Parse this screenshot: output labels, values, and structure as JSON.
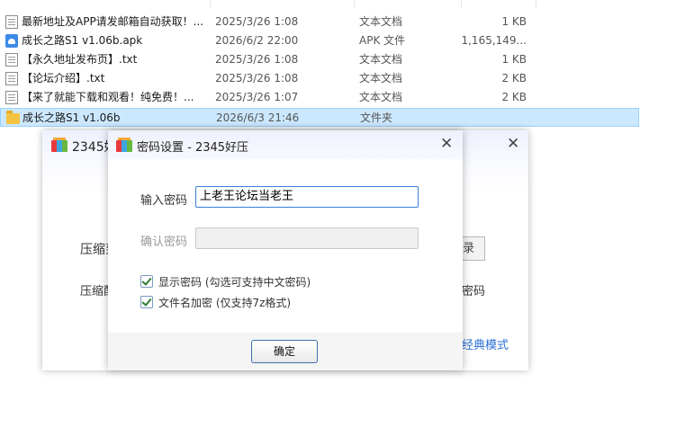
{
  "files": [
    {
      "name": "最新地址及APP请发邮箱自动获取！...",
      "date": "2025/3/26 1:08",
      "type": "文本文档",
      "size": "1 KB",
      "icon": "text-file-icon"
    },
    {
      "name": "成长之路S1 v1.06b.apk",
      "date": "2026/6/2 22:00",
      "type": "APK 文件",
      "size": "1,165,149...",
      "icon": "apk-file-icon"
    },
    {
      "name": "【永久地址发布页】.txt",
      "date": "2025/3/26 1:08",
      "type": "文本文档",
      "size": "1 KB",
      "icon": "text-file-icon"
    },
    {
      "name": "【论坛介绍】.txt",
      "date": "2025/3/26 1:08",
      "type": "文本文档",
      "size": "2 KB",
      "icon": "text-file-icon"
    },
    {
      "name": "【来了就能下载和观看！纯免费！...",
      "date": "2025/3/26 1:07",
      "type": "文本文档",
      "size": "2 KB",
      "icon": "text-file-icon"
    },
    {
      "name": "成长之路S1 v1.06b",
      "date": "2026/6/3 21:46",
      "type": "文件夹",
      "size": "",
      "icon": "folder-icon",
      "selected": true
    }
  ],
  "back_dialog": {
    "title": "2345好",
    "close": "✕",
    "label_1": "压缩到",
    "label_2": "压缩配",
    "browse_label": "录",
    "password_text": "密码",
    "classic_mode": "经典模式"
  },
  "password_dialog": {
    "title": "密码设置 - 2345好压",
    "close": "✕",
    "enter_label": "输入密码",
    "password_value": "上老王论坛当老王",
    "confirm_label": "确认密码",
    "confirm_value": "",
    "show_password": {
      "label": "显示密码 (勾选可支持中文密码)",
      "checked": true
    },
    "encrypt_names": {
      "label": "文件名加密  (仅支持7z格式)",
      "checked": true
    },
    "ok_label": "确定"
  },
  "colors": {
    "selection": "#cce8ff",
    "accent": "#3c7fd6",
    "link": "#2a6fd6"
  }
}
